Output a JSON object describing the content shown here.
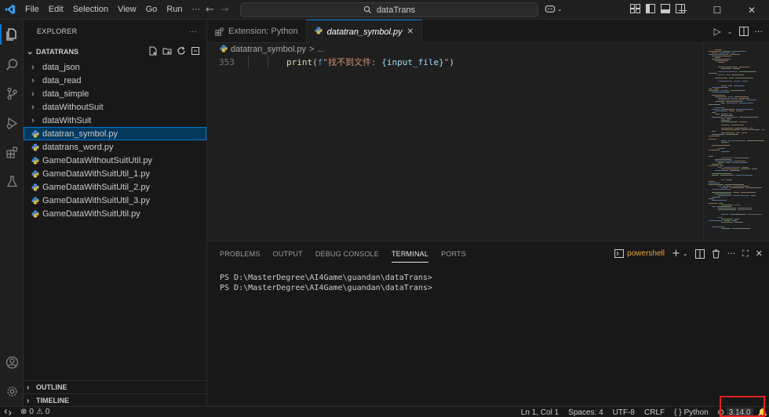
{
  "titlebar": {
    "menu": [
      "File",
      "Edit",
      "Selection",
      "View",
      "Go",
      "Run",
      "···"
    ],
    "search_text": "dataTrans"
  },
  "explorer": {
    "header": "EXPLORER",
    "more": "···",
    "root": "DATATRANS",
    "items": [
      {
        "label": "data_json",
        "type": "folder"
      },
      {
        "label": "data_read",
        "type": "folder"
      },
      {
        "label": "data_simple",
        "type": "folder"
      },
      {
        "label": "dataWithoutSuit",
        "type": "folder"
      },
      {
        "label": "dataWithSuit",
        "type": "folder"
      },
      {
        "label": "datatran_symbol.py",
        "type": "file",
        "selected": true
      },
      {
        "label": "datatrans_word.py",
        "type": "file"
      },
      {
        "label": "GameDataWithoutSuitUtil.py",
        "type": "file"
      },
      {
        "label": "GameDataWithSuitUtil_1.py",
        "type": "file"
      },
      {
        "label": "GameDataWithSuitUtil_2.py",
        "type": "file"
      },
      {
        "label": "GameDataWithSuitUtil_3.py",
        "type": "file"
      },
      {
        "label": "GameDataWithSuitUtil.py",
        "type": "file"
      }
    ],
    "outline": "OUTLINE",
    "timeline": "TIMELINE"
  },
  "tabs": [
    {
      "label": "Extension: Python",
      "active": false
    },
    {
      "label": "datatran_symbol.py",
      "active": true,
      "close": "✕"
    }
  ],
  "breadcrumb": {
    "file": "datatran_symbol.py",
    "sep": ">",
    "rest": "..."
  },
  "editor": {
    "line_number": "353",
    "code_fn": "print",
    "code_open": "(",
    "code_prefix": "f",
    "code_str_a": "\"找不到文件: ",
    "code_var": "{input_file}",
    "code_str_b": "\"",
    "code_close": ")"
  },
  "panel": {
    "tabs": [
      "PROBLEMS",
      "OUTPUT",
      "DEBUG CONSOLE",
      "TERMINAL",
      "PORTS"
    ],
    "active_tab": "TERMINAL",
    "shell": "powershell",
    "terminal_lines": [
      "PS D:\\MasterDegree\\AI4Game\\guandan\\dataTrans>",
      "PS D:\\MasterDegree\\AI4Game\\guandan\\dataTrans>"
    ]
  },
  "status": {
    "errors": "0",
    "warnings": "0",
    "position": "Ln 1, Col 1",
    "spaces": "Spaces: 4",
    "encoding": "UTF-8",
    "eol": "CRLF",
    "language_braces": "{ }",
    "language": "Python",
    "version": "3.14.0"
  },
  "colors": {
    "accent": "#0078d4",
    "highlight_box": "#e0201f",
    "code_function": "#dcdcaa",
    "code_string": "#ce9178",
    "code_keyword": "#569cd6",
    "code_variable": "#9cdcfe"
  }
}
